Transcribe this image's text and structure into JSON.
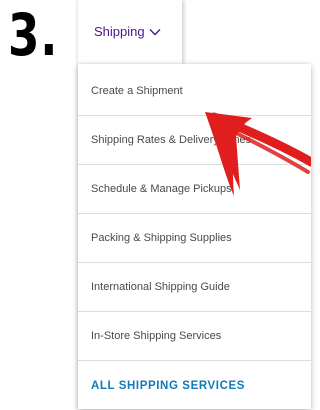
{
  "step": {
    "number": "3."
  },
  "nav": {
    "tab_label": "Shipping",
    "chevron_icon": "chevron-down-icon",
    "accent_color": "#4d148c"
  },
  "menu": {
    "items": [
      {
        "label": "Create a Shipment"
      },
      {
        "label": "Shipping Rates & Delivery Times"
      },
      {
        "label": "Schedule & Manage Pickups"
      },
      {
        "label": "Packing & Shipping Supplies"
      },
      {
        "label": "International Shipping Guide"
      },
      {
        "label": "In-Store Shipping Services"
      }
    ],
    "all_services_label": "ALL SHIPPING SERVICES",
    "link_color": "#0f7bb8"
  },
  "annotation": {
    "arrow_icon": "red-arrow-icon",
    "arrow_color": "#e01e1e"
  }
}
